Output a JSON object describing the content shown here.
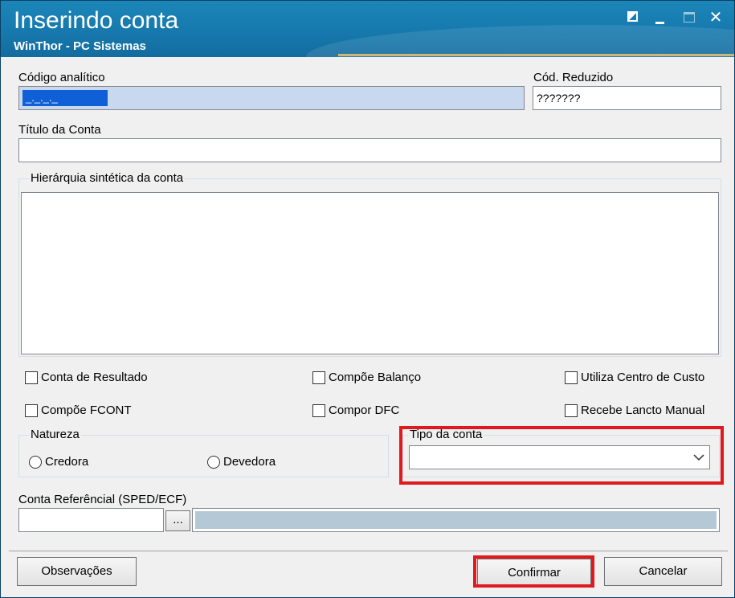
{
  "window": {
    "title": "Inserindo conta",
    "subtitle": "WinThor - PC Sistemas"
  },
  "form": {
    "codigo_analitico_label": "Código analítico",
    "codigo_analitico_value": "_._._._",
    "cod_reduzido_label": "Cód. Reduzido",
    "cod_reduzido_value": "???????",
    "titulo_label": "Título da Conta",
    "titulo_value": "",
    "hierarquia_label": "Hierárquia sintética da conta",
    "checkboxes": {
      "conta_resultado": "Conta de Resultado",
      "compoe_balanco": "Compõe Balanço",
      "utiliza_centro_custo": "Utiliza Centro de Custo",
      "compoe_fcont": "Compõe FCONT",
      "compor_dfc": "Compor DFC",
      "recebe_lancto_manual": "Recebe Lancto Manual"
    },
    "natureza": {
      "label": "Natureza",
      "credora": "Credora",
      "devedora": "Devedora"
    },
    "tipo_conta": {
      "label": "Tipo da conta",
      "selected": ""
    },
    "conta_referencial": {
      "label": "Conta Referêncial (SPED/ECF)",
      "value": "",
      "browse_label": "...",
      "description": ""
    }
  },
  "buttons": {
    "observacoes": "Observações",
    "confirmar": "Confirmar",
    "cancelar": "Cancelar"
  },
  "colors": {
    "titlebar": "#1679ad",
    "highlight": "#e0191f",
    "selection": "#0f5fd6"
  }
}
